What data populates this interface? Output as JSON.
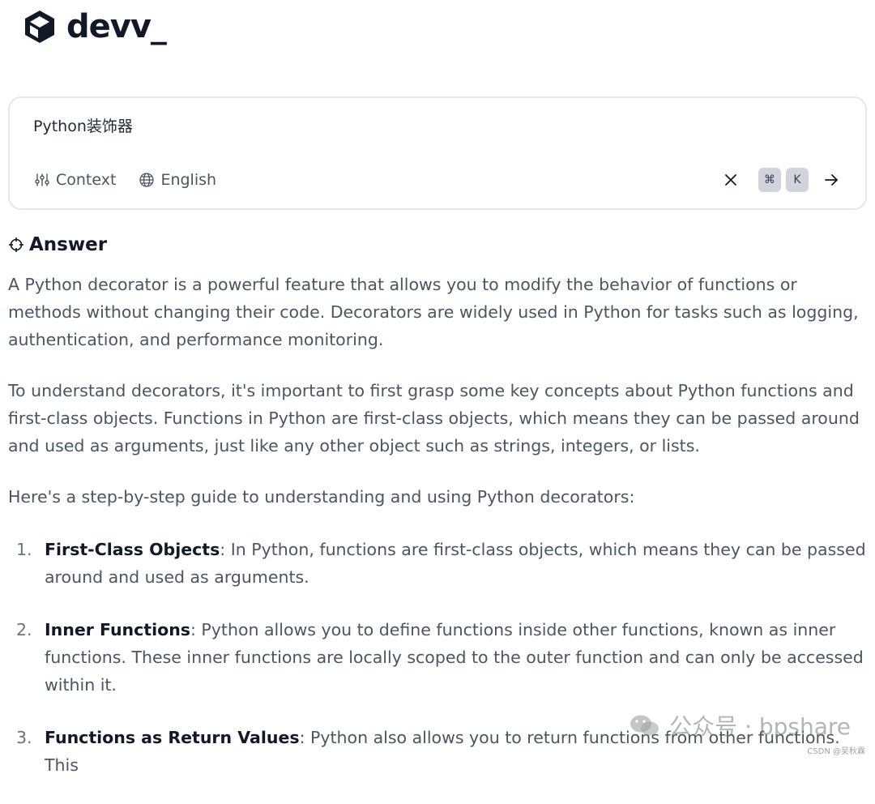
{
  "brand": {
    "name": "devv_"
  },
  "search": {
    "query": "Python装饰器",
    "tools": [
      {
        "label": "Context"
      },
      {
        "label": "English"
      }
    ],
    "shortcut": [
      "⌘",
      "K"
    ]
  },
  "answer": {
    "heading": "Answer",
    "paragraphs": [
      "A Python decorator is a powerful feature that allows you to modify the behavior of functions or methods without changing their code. Decorators are widely used in Python for tasks such as logging, authentication, and performance monitoring.",
      "To understand decorators, it's important to first grasp some key concepts about Python functions and first-class objects. Functions in Python are first-class objects, which means they can be passed around and used as arguments, just like any other object such as strings, integers, or lists.",
      "Here's a step-by-step guide to understanding and using Python decorators:"
    ],
    "steps": [
      {
        "num": "1.",
        "title": "First-Class Objects",
        "text": ": In Python, functions are first-class objects, which means they can be passed around and used as arguments."
      },
      {
        "num": "2.",
        "title": "Inner Functions",
        "text": ": Python allows you to define functions inside other functions, known as inner functions. These inner functions are locally scoped to the outer function and can only be accessed within it."
      },
      {
        "num": "3.",
        "title": "Functions as Return Values",
        "text": ": Python also allows you to return functions from other functions. This"
      }
    ]
  },
  "watermark": {
    "text": "公众号 · bpshare",
    "small": "CSDN @吴秋霖"
  },
  "colors": {
    "text": "#4b5563",
    "heading": "#111827",
    "border": "#e5e7eb",
    "kbd": "#d1d5db"
  }
}
